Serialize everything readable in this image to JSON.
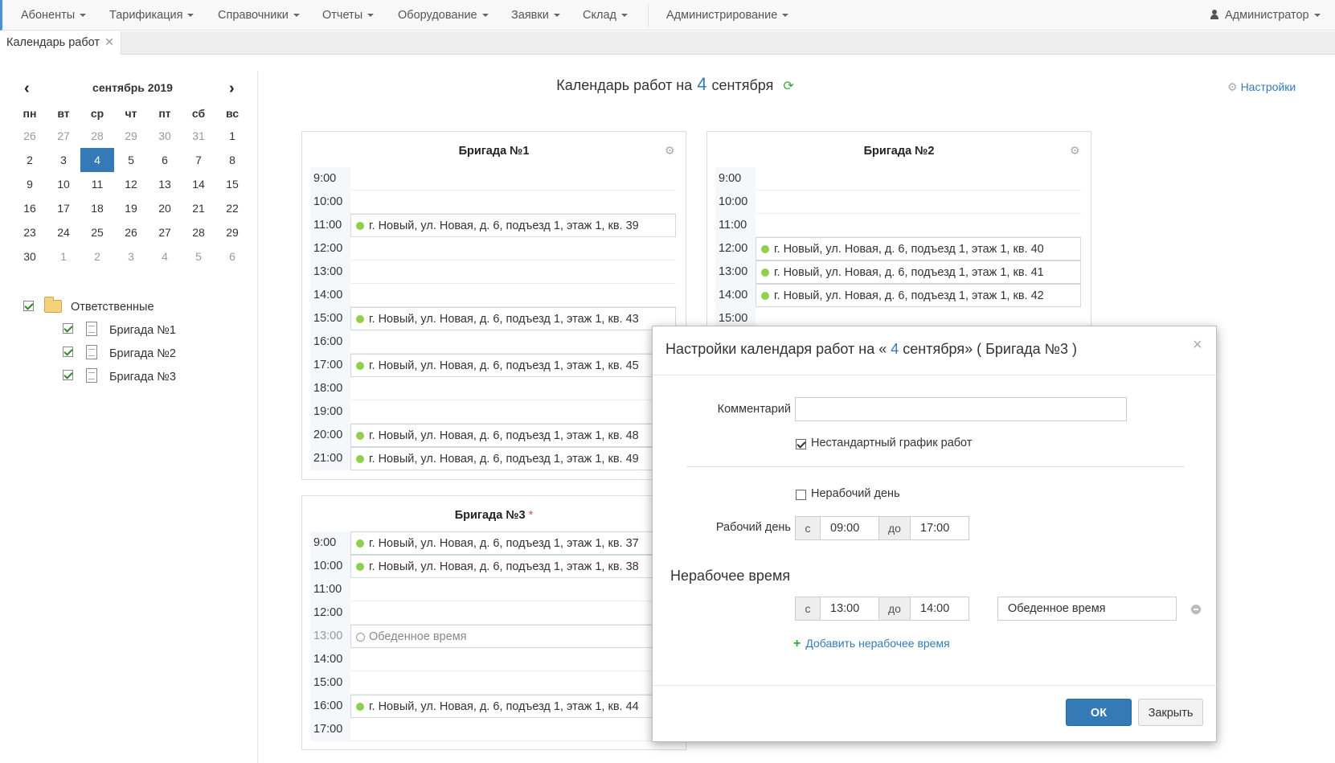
{
  "nav": {
    "items": [
      {
        "label": "Абоненты"
      },
      {
        "label": "Тарификация"
      },
      {
        "label": "Справочники"
      },
      {
        "label": "Отчеты"
      },
      {
        "label": "Оборудование"
      },
      {
        "label": "Заявки"
      },
      {
        "label": "Склад"
      },
      {
        "label": "Администрирование"
      }
    ],
    "user": "Администратор"
  },
  "tab": {
    "label": "Календарь работ"
  },
  "calendar": {
    "month": "сентябрь 2019",
    "weekdays": [
      "пн",
      "вт",
      "ср",
      "чт",
      "пт",
      "сб",
      "вс"
    ],
    "weeks": [
      [
        "26",
        "27",
        "28",
        "29",
        "30",
        "31",
        "1"
      ],
      [
        "2",
        "3",
        "4",
        "5",
        "6",
        "7",
        "8"
      ],
      [
        "9",
        "10",
        "11",
        "12",
        "13",
        "14",
        "15"
      ],
      [
        "16",
        "17",
        "18",
        "19",
        "20",
        "21",
        "22"
      ],
      [
        "23",
        "24",
        "25",
        "26",
        "27",
        "28",
        "29"
      ],
      [
        "30",
        "1",
        "2",
        "3",
        "4",
        "5",
        "6"
      ]
    ],
    "selected": "4"
  },
  "tree": {
    "root": "Ответственные",
    "children": [
      "Бригада №1",
      "Бригада №2",
      "Бригада №3"
    ]
  },
  "header": {
    "prefix": "Календарь работ на",
    "day": "4",
    "month": "сентября",
    "settings_label": "Настройки"
  },
  "brigades": [
    {
      "title": "Бригада №1",
      "slots": [
        {
          "time": "9:00",
          "text": ""
        },
        {
          "time": "10:00",
          "text": ""
        },
        {
          "time": "11:00",
          "text": "г. Новый, ул. Новая, д. 6, подъезд 1, этаж 1, кв. 39"
        },
        {
          "time": "12:00",
          "text": ""
        },
        {
          "time": "13:00",
          "text": ""
        },
        {
          "time": "14:00",
          "text": ""
        },
        {
          "time": "15:00",
          "text": "г. Новый, ул. Новая, д. 6, подъезд 1, этаж 1, кв. 43"
        },
        {
          "time": "16:00",
          "text": ""
        },
        {
          "time": "17:00",
          "text": "г. Новый, ул. Новая, д. 6, подъезд 1, этаж 1, кв. 45"
        },
        {
          "time": "18:00",
          "text": ""
        },
        {
          "time": "19:00",
          "text": ""
        },
        {
          "time": "20:00",
          "text": "г. Новый, ул. Новая, д. 6, подъезд 1, этаж 1, кв. 48"
        },
        {
          "time": "21:00",
          "text": "г. Новый, ул. Новая, д. 6, подъезд 1, этаж 1, кв. 49"
        }
      ]
    },
    {
      "title": "Бригада №2",
      "slots": [
        {
          "time": "9:00",
          "text": ""
        },
        {
          "time": "10:00",
          "text": ""
        },
        {
          "time": "11:00",
          "text": ""
        },
        {
          "time": "12:00",
          "text": "г. Новый, ул. Новая, д. 6, подъезд 1, этаж 1, кв. 40"
        },
        {
          "time": "13:00",
          "text": "г. Новый, ул. Новая, д. 6, подъезд 1, этаж 1, кв. 41"
        },
        {
          "time": "14:00",
          "text": "г. Новый, ул. Новая, д. 6, подъезд 1, этаж 1, кв. 42"
        },
        {
          "time": "15:00",
          "text": ""
        }
      ]
    },
    {
      "title": "Бригада №3",
      "required_mark": "*",
      "slots": [
        {
          "time": "9:00",
          "text": "г. Новый, ул. Новая, д. 6, подъезд 1, этаж 1, кв. 37"
        },
        {
          "time": "10:00",
          "text": "г. Новый, ул. Новая, д. 6, подъезд 1, этаж 1, кв. 38"
        },
        {
          "time": "11:00",
          "text": ""
        },
        {
          "time": "12:00",
          "text": ""
        },
        {
          "time": "13:00",
          "text": "Обеденное время",
          "off": true
        },
        {
          "time": "14:00",
          "text": ""
        },
        {
          "time": "15:00",
          "text": ""
        },
        {
          "time": "16:00",
          "text": "г. Новый, ул. Новая, д. 6, подъезд 1, этаж 1, кв. 44"
        },
        {
          "time": "17:00",
          "text": ""
        }
      ]
    }
  ],
  "modal": {
    "title_prefix": "Настройки календаря работ на «",
    "title_day": "4",
    "title_suffix": "сентября» ( Бригада №3 )",
    "comment_label": "Комментарий",
    "comment_value": "",
    "nonstandard_label": "Нестандартный график работ",
    "nonstandard_checked": true,
    "dayoff_label": "Нерабочий день",
    "dayoff_checked": false,
    "workday_label": "Рабочий день",
    "from_label": "с",
    "to_label": "до",
    "work_from": "09:00",
    "work_to": "17:00",
    "break_heading": "Нерабочее время",
    "break_from": "13:00",
    "break_to": "14:00",
    "break_name": "Обеденное время",
    "add_break_label": "Добавить нерабочее время",
    "ok_label": "ОК",
    "close_label": "Закрыть"
  }
}
